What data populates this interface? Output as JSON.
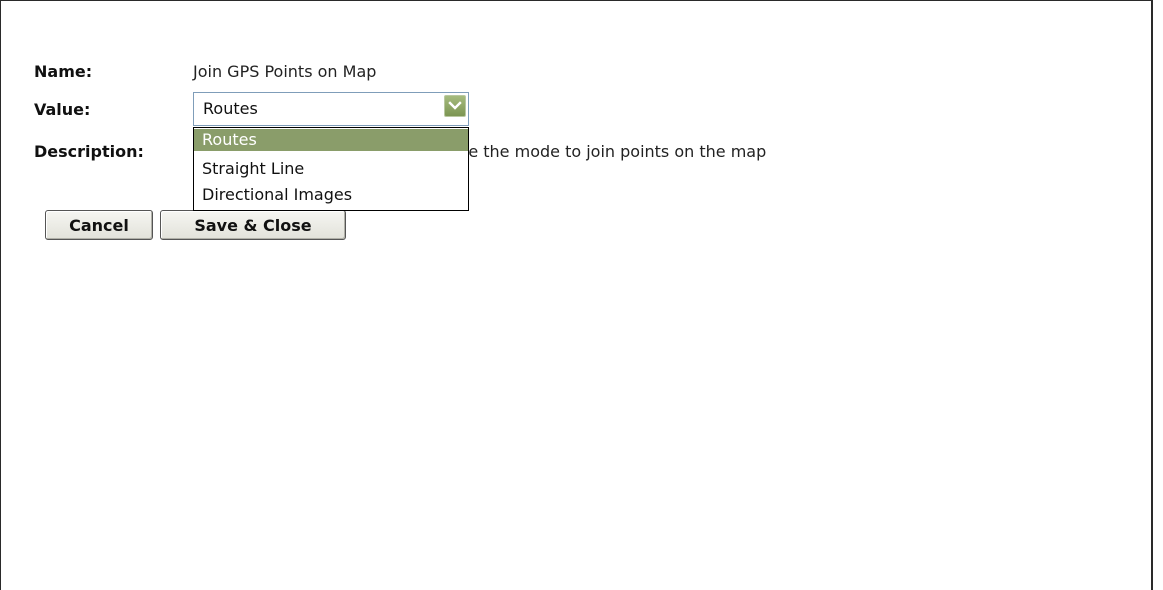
{
  "fields": {
    "name_label": "Name:",
    "name_value": "Join GPS Points on Map",
    "value_label": "Value:",
    "description_label": "Description:",
    "description_value": "se the mode to join points on the map"
  },
  "select": {
    "current": "Routes",
    "options": [
      "Routes",
      "Straight Line",
      "Directional Images"
    ],
    "selected_index": 0,
    "highlight_color": "#8a9d6a"
  },
  "buttons": {
    "cancel": "Cancel",
    "save_close": "Save & Close"
  },
  "icons": {
    "dropdown_arrow": "chevron-down-icon"
  }
}
